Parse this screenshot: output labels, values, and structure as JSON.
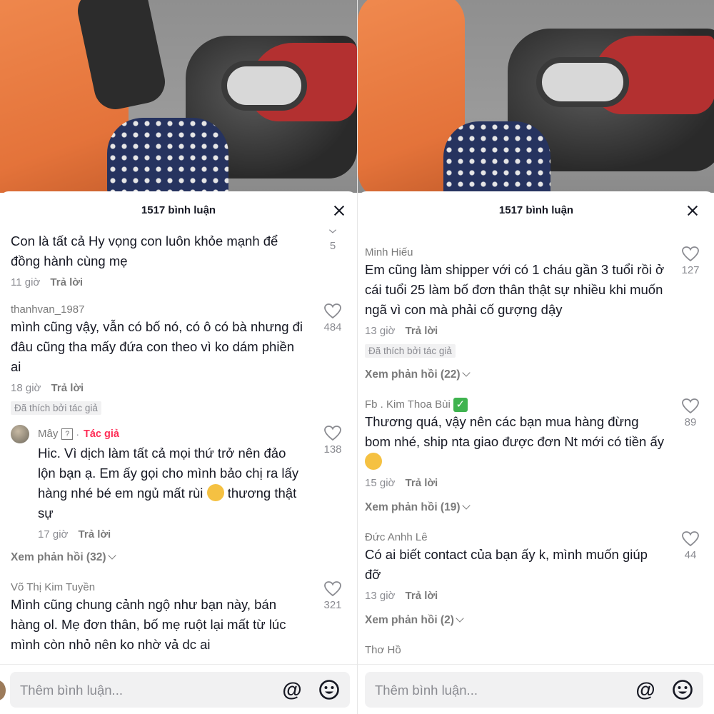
{
  "left": {
    "header": {
      "title": "1517 bình luận"
    },
    "top_comment": {
      "text": "Con là tất cả Hy vọng con luôn khỏe mạnh để đồng hành cùng mẹ",
      "time": "11 giờ",
      "reply": "Trả lời",
      "count": "5"
    },
    "comments": [
      {
        "username": "thanhvan_1987",
        "text": "mình cũng vậy, vẫn có bố nó, có ô có bà nhưng đi đâu cũng tha mấy đứa con theo vì ko dám phiền ai",
        "time": "18 giờ",
        "reply": "Trả lời",
        "badge": "Đã thích bởi tác giả",
        "likes": "484"
      },
      {
        "username": "Mây",
        "author_tag": "Tác giả",
        "qbox": "?",
        "text_1": "Hic. Vì dịch làm tất cả mọi thứ trở nên đảo lộn bạn ạ. Em ấy gọi cho mình bảo chị ra lấy hàng nhé bé em ngủ mất rùi",
        "text_2": "thương thật sự",
        "time": "17 giờ",
        "reply": "Trả lời",
        "likes": "138",
        "separator": "·"
      },
      {
        "view_replies": "Xem phản hồi (32)"
      },
      {
        "username": "Võ Thị Kim Tuyền",
        "text": "Mình cũng chung cảnh ngộ như bạn này, bán hàng ol. Mẹ đơn thân, bố mẹ ruột lại mất từ lúc mình còn nhỏ nên ko nhờ vả dc ai",
        "likes": "321"
      }
    ],
    "input": {
      "placeholder": "Thêm bình luận...",
      "at_symbol": "@"
    }
  },
  "right": {
    "header": {
      "title": "1517 bình luận"
    },
    "comments": [
      {
        "username": "Minh Hiếu",
        "text": "Em cũng làm shipper với có 1 cháu gần 3 tuổi rồi ở cái tuổi 25 làm bố đơn thân thật sự nhiều khi muốn ngã vì con mà phải cố gượng dậy",
        "time": "13 giờ",
        "reply": "Trả lời",
        "badge": "Đã thích bởi tác giả",
        "likes": "127",
        "view_replies": "Xem phản hồi (22)"
      },
      {
        "username": "Fb . Kim Thoa Bùi",
        "check": "✓",
        "text": "Thương quá, vậy nên các bạn mua hàng đừng bom nhé, ship nta giao được đơn Nt mới có tiền ấy",
        "time": "15 giờ",
        "reply": "Trả lời",
        "likes": "89",
        "view_replies": "Xem phản hồi (19)"
      },
      {
        "username": "Đức Anhh Lê",
        "text": "Có ai biết contact của bạn ấy k, mình muốn giúp đỡ",
        "time": "13 giờ",
        "reply": "Trả lời",
        "likes": "44",
        "view_replies": "Xem phản hồi (2)"
      },
      {
        "username": "Thơ Hồ"
      }
    ],
    "input": {
      "placeholder": "Thêm bình luận...",
      "at_symbol": "@"
    }
  },
  "colors": {
    "author_tag": "#fe2c55",
    "check_badge": "#3fb34f",
    "text": "#161823",
    "muted": "#8a8b91"
  },
  "icons": [
    "close-icon",
    "heart-icon",
    "chevron-down-icon",
    "at-icon",
    "emoji-icon",
    "green-check-icon"
  ]
}
